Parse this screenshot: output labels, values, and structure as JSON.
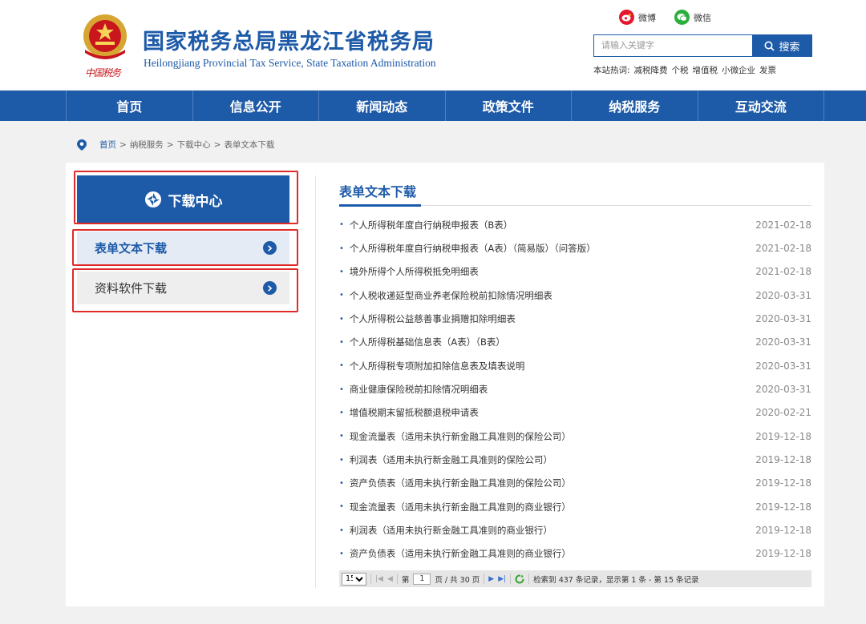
{
  "header": {
    "title": "国家税务总局黑龙江省税务局",
    "subtitle": "Heilongjiang Provincial Tax Service, State Taxation Administration",
    "emblem_caption": "中国税务",
    "emblem_icon": "national-tax-emblem",
    "social": [
      {
        "label": "微博",
        "icon": "weibo-icon"
      },
      {
        "label": "微信",
        "icon": "wechat-icon"
      }
    ],
    "search": {
      "placeholder": "请输入关键字",
      "button_label": "搜索"
    },
    "hotwords_label": "本站热词:",
    "hotwords": [
      "减税降费",
      "个税",
      "增值税",
      "小微企业",
      "发票"
    ]
  },
  "nav": [
    "首页",
    "信息公开",
    "新闻动态",
    "政策文件",
    "纳税服务",
    "互动交流"
  ],
  "breadcrumb": {
    "items": [
      "首页",
      "纳税服务",
      "下载中心",
      "表单文本下载"
    ],
    "separator": ">"
  },
  "sidebar": {
    "heading": "下载中心",
    "items": [
      {
        "label": "表单文本下载",
        "active": true
      },
      {
        "label": "资料软件下载",
        "active": false
      }
    ]
  },
  "list": {
    "title": "表单文本下载",
    "items": [
      {
        "name": "个人所得税年度自行纳税申报表（B表）",
        "date": "2021-02-18"
      },
      {
        "name": "个人所得税年度自行纳税申报表（A表）（简易版）（问答版）",
        "date": "2021-02-18"
      },
      {
        "name": "境外所得个人所得税抵免明细表",
        "date": "2021-02-18"
      },
      {
        "name": "个人税收递延型商业养老保险税前扣除情况明细表",
        "date": "2020-03-31"
      },
      {
        "name": "个人所得税公益慈善事业捐赠扣除明细表",
        "date": "2020-03-31"
      },
      {
        "name": "个人所得税基础信息表（A表）（B表）",
        "date": "2020-03-31"
      },
      {
        "name": "个人所得税专项附加扣除信息表及填表说明",
        "date": "2020-03-31"
      },
      {
        "name": "商业健康保险税前扣除情况明细表",
        "date": "2020-03-31"
      },
      {
        "name": "增值税期末留抵税额退税申请表",
        "date": "2020-02-21"
      },
      {
        "name": "现金流量表（适用未执行新金融工具准则的保险公司）",
        "date": "2019-12-18"
      },
      {
        "name": "利润表（适用未执行新金融工具准则的保险公司）",
        "date": "2019-12-18"
      },
      {
        "name": "资产负债表（适用未执行新金融工具准则的保险公司）",
        "date": "2019-12-18"
      },
      {
        "name": "现金流量表（适用未执行新金融工具准则的商业银行）",
        "date": "2019-12-18"
      },
      {
        "name": "利润表（适用未执行新金融工具准则的商业银行）",
        "date": "2019-12-18"
      },
      {
        "name": "资产负债表（适用未执行新金融工具准则的商业银行）",
        "date": "2019-12-18"
      }
    ]
  },
  "pager": {
    "page_size": "15",
    "page_prefix": "第",
    "current_page": "1",
    "page_suffix": "页 / 共 30 页",
    "summary": "检索到 437 条记录，显示第 1 条 - 第 15 条记录"
  },
  "colors": {
    "brand_blue": "#1d5aa8",
    "highlight_red": "#e02a2a",
    "weibo_red": "#e6162d",
    "wechat_green": "#2aae3c"
  }
}
